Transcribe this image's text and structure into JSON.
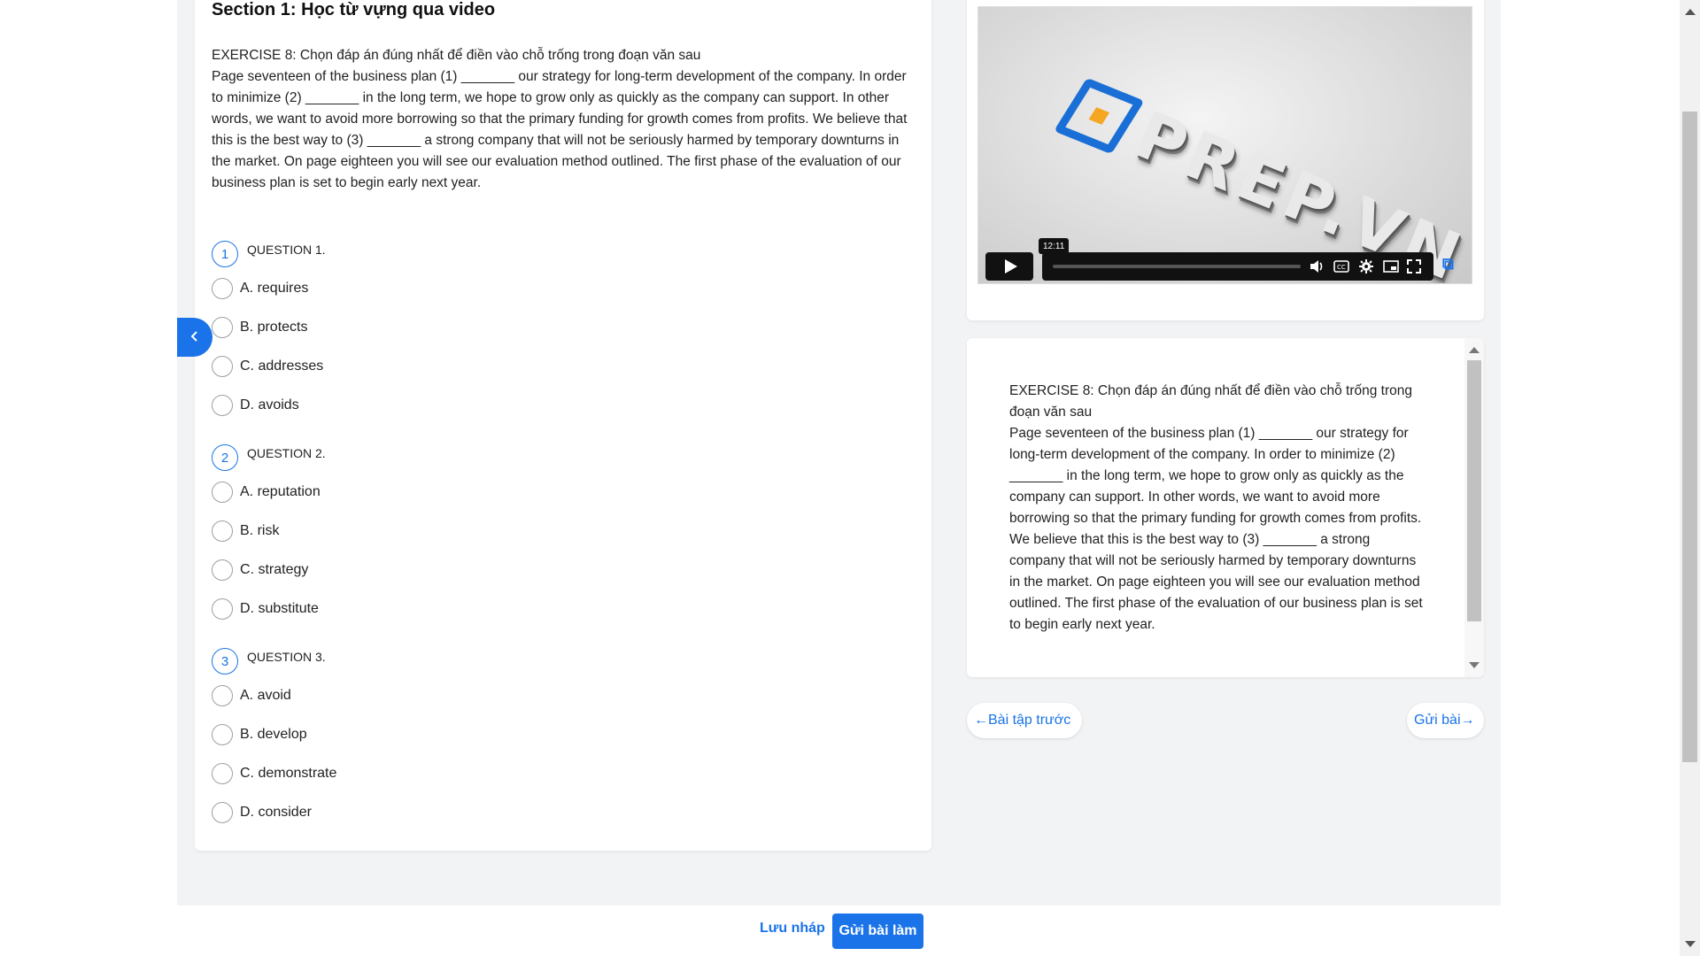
{
  "section": {
    "title": "Section 1: Học từ vựng qua video"
  },
  "exercise": {
    "instruction": "EXERCISE 8: Chọn đáp án đúng nhất để điền vào chỗ trống trong đoạn văn sau",
    "passage": "Page seventeen of the business plan (1) _______ our strategy for long-term development of the company. In order to minimize (2) _______ in the long term, we hope to grow only as quickly as the company can support. In other words, we want to avoid more borrowing so that the primary funding for growth comes from profits. We believe that this is the best way to (3) _______ a strong company that will not be seriously harmed by temporary downturns in the market. On page eighteen you will see our evaluation method outlined. The first phase of the evaluation of our business plan is set to begin early next year."
  },
  "questions": [
    {
      "number": "1",
      "label": "QUESTION 1.",
      "options": [
        "A. requires",
        "B. protects",
        "C. addresses",
        "D. avoids"
      ]
    },
    {
      "number": "2",
      "label": "QUESTION 2.",
      "options": [
        "A. reputation",
        "B. risk",
        "C. strategy",
        "D. substitute"
      ]
    },
    {
      "number": "3",
      "label": "QUESTION 3.",
      "options": [
        "A. avoid",
        "B. develop",
        "C. demonstrate",
        "D. consider"
      ]
    }
  ],
  "video": {
    "logo_text": "PREP.VN",
    "time_tooltip": "12:11",
    "progress": 0.0,
    "controls": [
      "play-icon",
      "volume-icon",
      "captions-icon",
      "settings-icon",
      "pip-icon",
      "fullscreen-icon"
    ]
  },
  "navigation": {
    "prev_label": "←Bài tập trước",
    "next_label": "Gửi bài→"
  },
  "footer": {
    "save_draft_label": "Lưu nháp",
    "submit_label": "Gửi bài làm"
  },
  "side_toggle": {
    "icon": "chevron-left-icon"
  },
  "colors": {
    "accent": "#1a73e8",
    "logo_orange": "#f5a623"
  }
}
